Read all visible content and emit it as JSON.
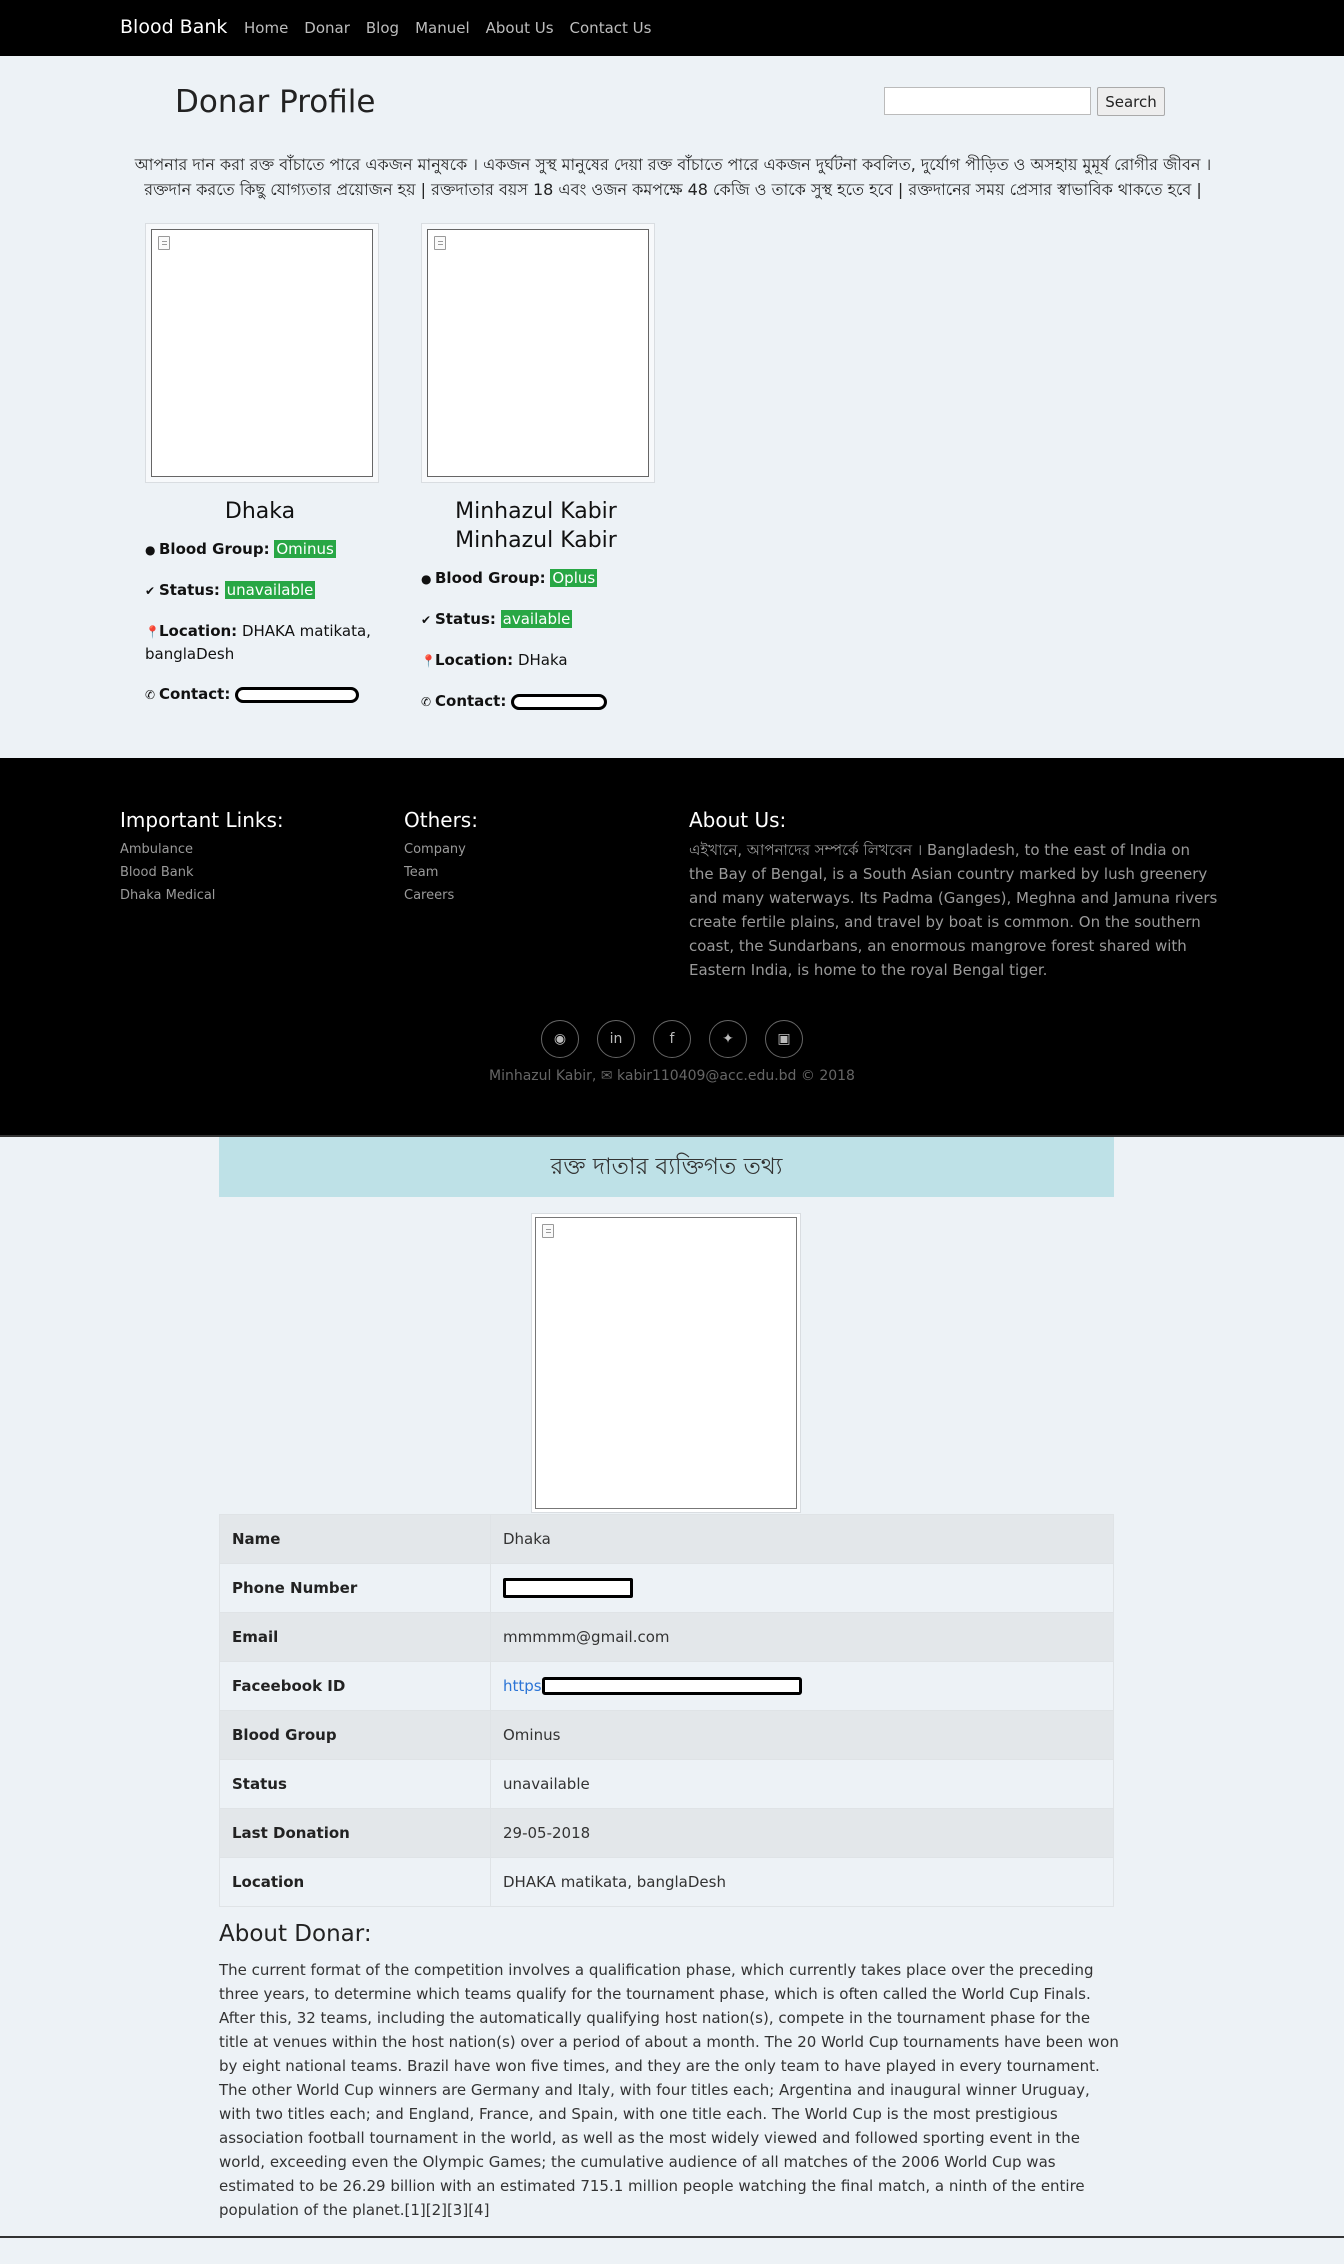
{
  "navbar": {
    "brand": "Blood Bank",
    "links": [
      "Home",
      "Donar",
      "Blog",
      "Manuel",
      "About Us",
      "Contact Us"
    ]
  },
  "header": {
    "title": "Donar Profile",
    "search_button": "Search",
    "search_value": ""
  },
  "intro_text": "আপনার দান করা রক্ত বাঁচাতে পারে একজন মানুষকে । একজন সুস্থ মানুষের দেয়া রক্ত বাঁচাতে পারে একজন দুর্ঘটনা কবলিত, দুর্যোগ পীড়িত ও অসহায় মুমূর্ষ রোগীর জীবন । রক্তদান করতে কিছু যোগ্যতার প্রয়োজন হয় | রক্তদাতার বয়স 18 এবং ওজন কমপক্ষে 48 কেজি ও তাকে সুস্থ হতে হবে | রক্তদানের সময় প্রেসার স্বাভাবিক থাকতে হবে |",
  "labels": {
    "blood_group": "Blood Group:",
    "status": "Status:",
    "location": "Location:",
    "contact": "Contact:"
  },
  "donors": [
    {
      "name": "Dhaka",
      "blood_group": "Ominus",
      "status": "unavailable",
      "location": "DHAKA matikata, banglaDesh"
    },
    {
      "name": "Minhazul Kabir Minhazul Kabir",
      "blood_group": "Oplus",
      "status": "available",
      "location": "DHaka"
    }
  ],
  "footer": {
    "links_title": "Important Links:",
    "links": [
      "Ambulance",
      "Blood Bank",
      "Dhaka Medical"
    ],
    "others_title": "Others:",
    "others": [
      "Company",
      "Team",
      "Careers"
    ],
    "about_title": "About Us:",
    "about_text": "এইখানে, আপনাদের সম্পর্কে লিখবেন । Bangladesh, to the east of India on the Bay of Bengal, is a South Asian country marked by lush greenery and many waterways. Its Padma (Ganges), Meghna and Jamuna rivers create fertile plains, and travel by boat is common. On the southern coast, the Sundarbans, an enormous mangrove forest shared with Eastern India, is home to the royal Bengal tiger.",
    "social_icons": [
      "github-icon",
      "linkedin-icon",
      "facebook-icon",
      "twitter-icon",
      "instagram-icon"
    ],
    "copyright": "Minhazul Kabir, ✉ kabir110409@acc.edu.bd © 2018"
  },
  "details": {
    "header": "রক্ত দাতার ব্যক্তিগত তথ্য",
    "rows": {
      "name_label": "Name",
      "name_value": "Dhaka",
      "phone_label": "Phone Number",
      "email_label": "Email",
      "email_value": "mmmmm@gmail.com",
      "facebook_label": "Faceebook ID",
      "facebook_value": "https",
      "blood_label": "Blood Group",
      "blood_value": "Ominus",
      "status_label": "Status",
      "status_value": "unavailable",
      "last_label": "Last Donation",
      "last_value": "29-05-2018",
      "location_label": "Location",
      "location_value": "DHAKA matikata, banglaDesh"
    },
    "about_title": "About Donar:",
    "about_text": "The current format of the competition involves a qualification phase, which currently takes place over the preceding three years, to determine which teams qualify for the tournament phase, which is often called the World Cup Finals. After this, 32 teams, including the automatically qualifying host nation(s), compete in the tournament phase for the title at venues within the host nation(s) over a period of about a month. The 20 World Cup tournaments have been won by eight national teams. Brazil have won five times, and they are the only team to have played in every tournament. The other World Cup winners are Germany and Italy, with four titles each; Argentina and inaugural winner Uruguay, with two titles each; and England, France, and Spain, with one title each. The World Cup is the most prestigious association football tournament in the world, as well as the most widely viewed and followed sporting event in the world, exceeding even the Olympic Games; the cumulative audience of all matches of the 2006 World Cup was estimated to be 26.29 billion with an estimated 715.1 million people watching the final match, a ninth of the entire population of the planet.[1][2][3][4]"
  }
}
